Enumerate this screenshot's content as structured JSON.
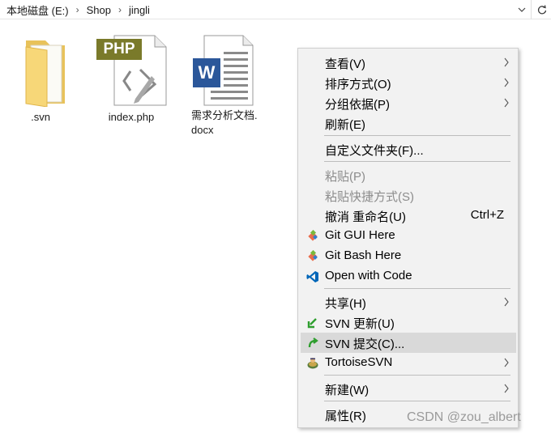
{
  "address_bar": {
    "crumbs": [
      "本地磁盘 (E:)",
      "Shop",
      "jingli"
    ]
  },
  "files": [
    {
      "label": ".svn",
      "icon": "folder-icon"
    },
    {
      "label": "index.php",
      "icon": "php-file-icon",
      "badge": "PHP"
    },
    {
      "label": "需求分析文档.\ndocx",
      "icon": "word-document-icon",
      "badge": "W"
    }
  ],
  "context_menu": {
    "items": [
      {
        "label": "查看(V)",
        "submenu": true
      },
      {
        "label": "排序方式(O)",
        "submenu": true
      },
      {
        "label": "分组依据(P)",
        "submenu": true
      },
      {
        "label": "刷新(E)"
      },
      {
        "label": "自定义文件夹(F)..."
      },
      {
        "label": "粘贴(P)",
        "disabled": true
      },
      {
        "label": "粘贴快捷方式(S)",
        "disabled": true
      },
      {
        "label": "撤消 重命名(U)",
        "shortcut": "Ctrl+Z"
      },
      {
        "label": "Git GUI Here",
        "icon": "git-gui-icon"
      },
      {
        "label": "Git Bash Here",
        "icon": "git-bash-icon"
      },
      {
        "label": "Open with Code",
        "icon": "vscode-icon"
      },
      {
        "label": "共享(H)",
        "submenu": true
      },
      {
        "label": "SVN 更新(U)",
        "icon": "svn-update-icon"
      },
      {
        "label": "SVN 提交(C)...",
        "icon": "svn-commit-icon",
        "highlighted": true
      },
      {
        "label": "TortoiseSVN",
        "icon": "tortoisesvn-icon",
        "submenu": true
      },
      {
        "label": "新建(W)",
        "submenu": true
      },
      {
        "label": "属性(R)"
      }
    ]
  },
  "watermark": "CSDN @zou_albert",
  "colors": {
    "menu_background": "#f2f2f2",
    "menu_highlight": "#d9d9d9",
    "disabled_text": "#8c8c8c",
    "php_badge": "#7a7a2a",
    "word_blue": "#2b579a",
    "folder_yellow": "#f7d778",
    "vscode_blue": "#0066b8",
    "svn_green": "#2e9e2e"
  }
}
